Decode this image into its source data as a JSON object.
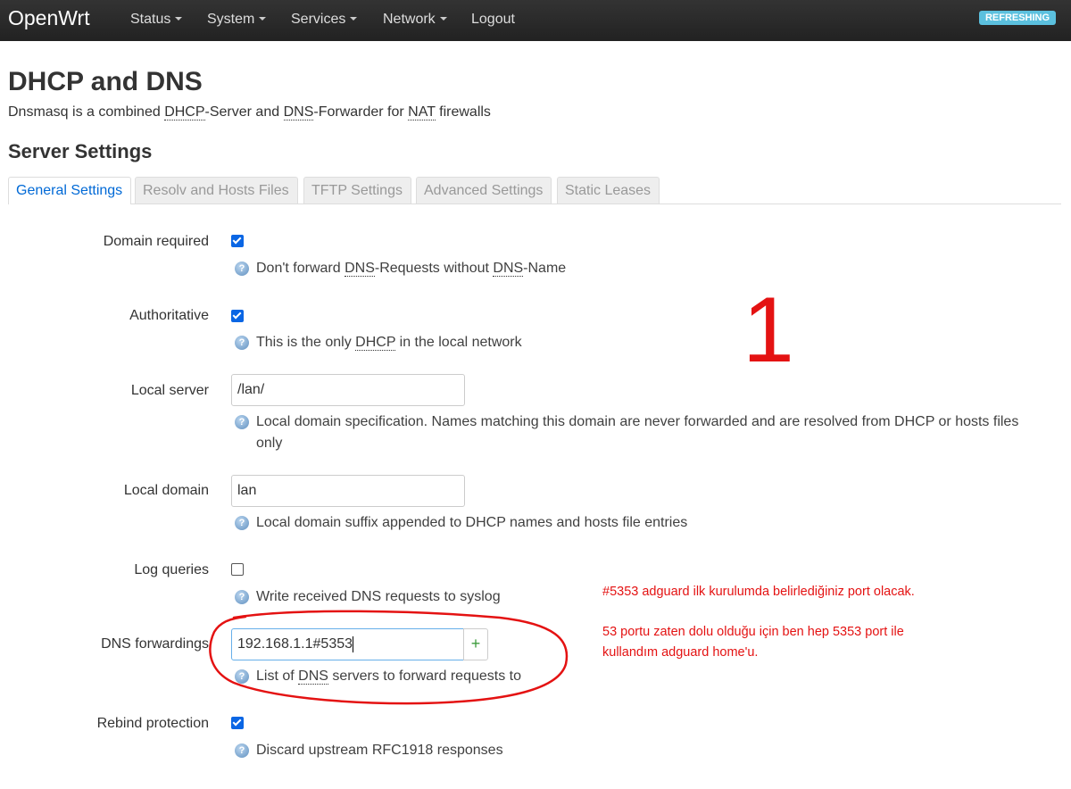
{
  "nav": {
    "brand": "OpenWrt",
    "items": [
      {
        "label": "Status",
        "dropdown": true
      },
      {
        "label": "System",
        "dropdown": true
      },
      {
        "label": "Services",
        "dropdown": true
      },
      {
        "label": "Network",
        "dropdown": true
      },
      {
        "label": "Logout",
        "dropdown": false
      }
    ],
    "badge": "REFRESHING"
  },
  "page": {
    "title": "DHCP and DNS",
    "desc": {
      "p1": "Dnsmasq is a combined ",
      "a1": "DHCP",
      "p2": "-Server and ",
      "a2": "DNS",
      "p3": "-Forwarder for ",
      "a3": "NAT",
      "p4": " firewalls"
    },
    "section": "Server Settings"
  },
  "tabs": [
    "General Settings",
    "Resolv and Hosts Files",
    "TFTP Settings",
    "Advanced Settings",
    "Static Leases"
  ],
  "fields": {
    "domain_required": {
      "label": "Domain required",
      "checked": true,
      "help": {
        "p1": "Don't forward ",
        "a1": "DNS",
        "p2": "-Requests without ",
        "a2": "DNS",
        "p3": "-Name"
      }
    },
    "authoritative": {
      "label": "Authoritative",
      "checked": true,
      "help": {
        "p1": "This is the only ",
        "a1": "DHCP",
        "p2": " in the local network"
      }
    },
    "local_server": {
      "label": "Local server",
      "value": "/lan/",
      "help": "Local domain specification. Names matching this domain are never forwarded and are resolved from DHCP or hosts files only"
    },
    "local_domain": {
      "label": "Local domain",
      "value": "lan",
      "help": "Local domain suffix appended to DHCP names and hosts file entries"
    },
    "log_queries": {
      "label": "Log queries",
      "checked": false,
      "help": "Write received DNS requests to syslog"
    },
    "dns_forwardings": {
      "label": "DNS forwardings",
      "value": "192.168.1.1#5353",
      "add_glyph": "+",
      "help": {
        "p1": "List of ",
        "a1": "DNS",
        "p2": " servers to forward requests to"
      }
    },
    "rebind_protection": {
      "label": "Rebind protection",
      "checked": true,
      "help": "Discard upstream RFC1918 responses"
    }
  },
  "help_glyph": "?",
  "annotations": {
    "number": "1",
    "note1": "#5353 adguard ilk kurulumda belirlediğiniz port olacak.",
    "note2_line1": "53 portu zaten dolu olduğu için ben hep 5353 port ile",
    "note2_line2": "kullandım adguard home'u.",
    "color": "#e41212"
  }
}
